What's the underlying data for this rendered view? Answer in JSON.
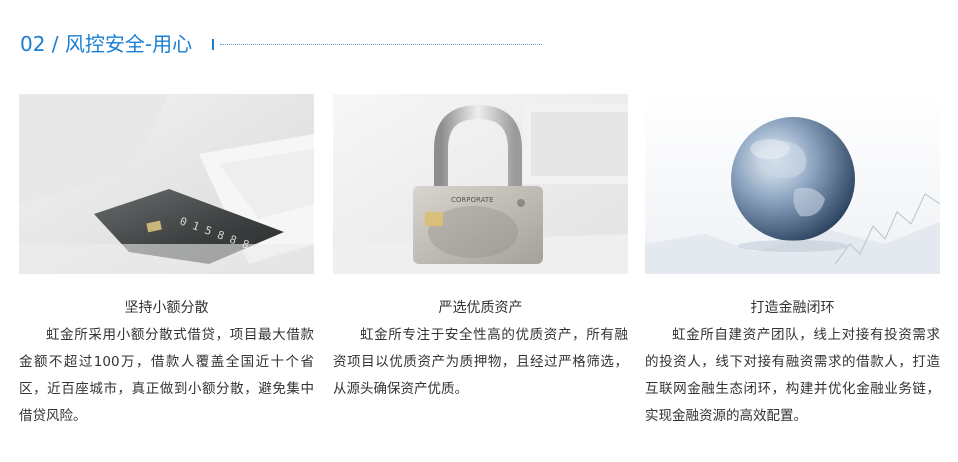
{
  "section": {
    "title": "02 / 风控安全-用心"
  },
  "cards": [
    {
      "heading": "坚持小额分散",
      "body": "虹金所采用小额分散式借贷，项目最大借款金额不超过100万，借款人覆盖全国近十个省区，近百座城市，真正做到小额分散，避免集中借贷风险。",
      "image_desc_icon": "credit-card-icon"
    },
    {
      "heading": "严选优质资产",
      "body": "虹金所专注于安全性高的优质资产，所有融资项目以优质资产为质押物，且经过严格筛选，从源头确保资产优质。",
      "image_desc_icon": "padlock-card-icon",
      "card_text": "CORPORATE"
    },
    {
      "heading": "打造金融闭环",
      "body": "虹金所自建资产团队，线上对接有投资需求的投资人，线下对接有融资需求的借款人，打造互联网金融生态闭环，构建并优化金融业务链，实现金融资源的高效配置。",
      "image_desc_icon": "globe-icon"
    }
  ],
  "colors": {
    "accent": "#1a7fd4",
    "text": "#333333"
  }
}
